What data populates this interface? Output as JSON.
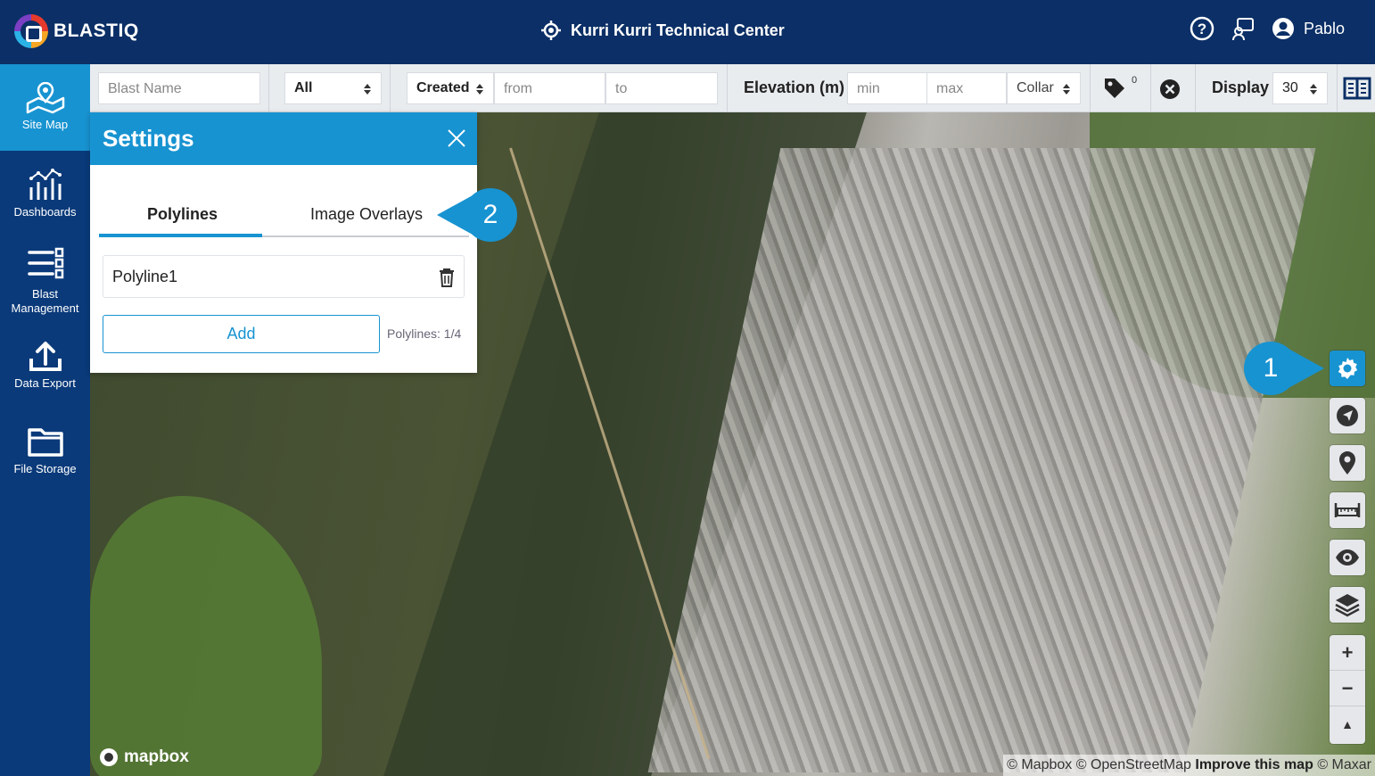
{
  "header": {
    "logo_text": "BLASTIQ",
    "site_name": "Kurri Kurri Technical Center",
    "user_name": "Pablo"
  },
  "sidebar": {
    "items": [
      {
        "label": "Site Map",
        "icon": "map-icon",
        "active": true
      },
      {
        "label": "Dashboards",
        "icon": "chart-icon",
        "active": false
      },
      {
        "label": "Blast Management",
        "icon": "list-icon",
        "active": false
      },
      {
        "label": "Data Export",
        "icon": "upload-icon",
        "active": false
      },
      {
        "label": "File Storage",
        "icon": "folder-icon",
        "active": false
      }
    ]
  },
  "filters": {
    "blast_name_placeholder": "Blast Name",
    "status_value": "All",
    "date_type_value": "Created",
    "from_placeholder": "from",
    "to_placeholder": "to",
    "elevation_label": "Elevation (m)",
    "min_placeholder": "min",
    "max_placeholder": "max",
    "elevation_ref_value": "Collar",
    "tag_count": "0",
    "display_label": "Display",
    "display_value": "30"
  },
  "settings": {
    "title": "Settings",
    "tabs": [
      {
        "label": "Polylines",
        "active": true
      },
      {
        "label": "Image Overlays",
        "active": false
      }
    ],
    "polylines": [
      {
        "name": "Polyline1"
      }
    ],
    "add_label": "Add",
    "count_text": "Polylines: 1/4"
  },
  "map": {
    "brand": "mapbox",
    "attribution_prefix": "© Mapbox © OpenStreetMap",
    "improve_link": "Improve this map",
    "attribution_suffix": "© Maxar",
    "controls": [
      "gear-icon",
      "navigate-icon",
      "pin-icon",
      "ruler-icon",
      "eye-icon",
      "layers-icon"
    ],
    "zoom_in": "+",
    "zoom_out": "−",
    "compass": "▲"
  },
  "callouts": {
    "first": "1",
    "second": "2"
  },
  "colors": {
    "header_bg": "#0b2f66",
    "sidebar_bg": "#0a3a7a",
    "accent": "#1893d1"
  }
}
